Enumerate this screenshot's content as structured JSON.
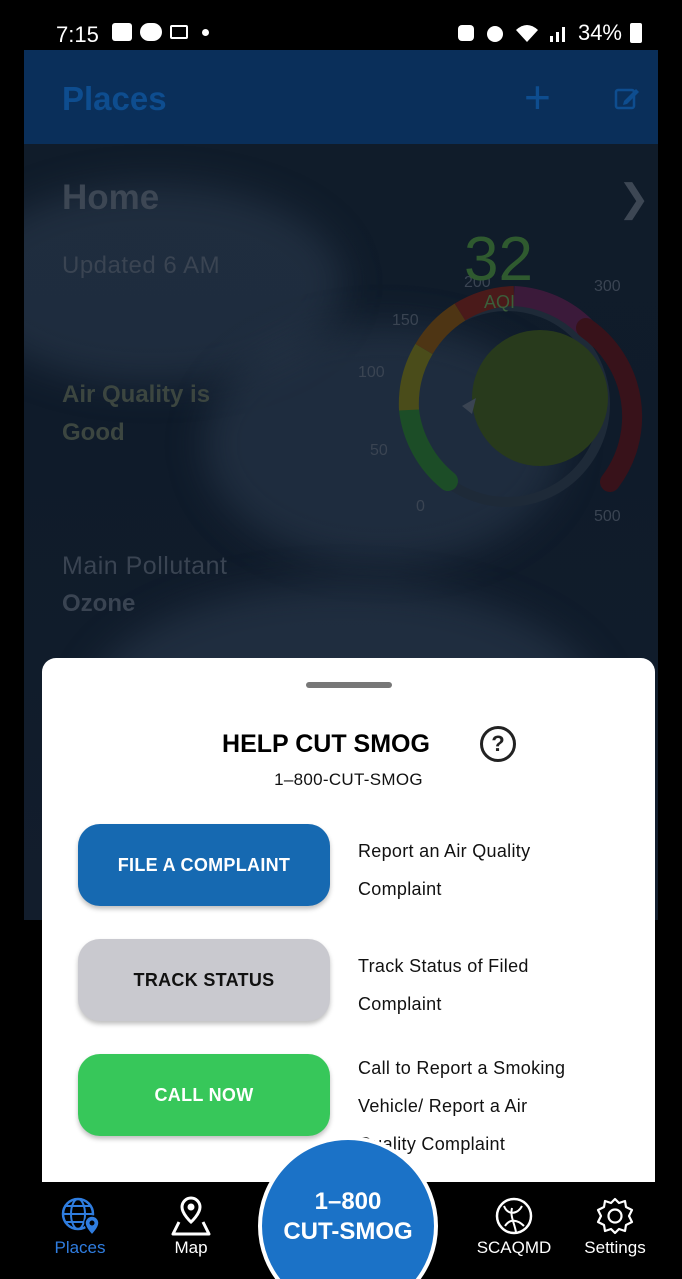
{
  "status_bar": {
    "time": "7:15",
    "battery": "34%"
  },
  "header": {
    "title": "Places",
    "add_icon": "plus-icon",
    "edit_icon": "edit-icon"
  },
  "place": {
    "name": "Home",
    "updated": "Updated 6 AM",
    "air_quality_line1": "Air Quality is",
    "air_quality_line2": "Good",
    "pollutant_label": "Main Pollutant",
    "pollutant_value": "Ozone",
    "aqi_value": "32",
    "aqi_unit": "AQI",
    "gauge_ticks": [
      "0",
      "50",
      "100",
      "150",
      "200",
      "300",
      "500"
    ],
    "gauge_colors": [
      "#37c75a",
      "#e8d21e",
      "#f08a1c",
      "#e0251c",
      "#8e2b8a",
      "#7a1020"
    ]
  },
  "sheet": {
    "title": "HELP CUT SMOG",
    "help_icon": "?",
    "subtitle": "1–800-CUT-SMOG",
    "actions": [
      {
        "label": "FILE A COMPLAINT",
        "description_line1": "Report an Air Quality",
        "description_line2": "Complaint",
        "color": "#1669b1"
      },
      {
        "label": "TRACK STATUS",
        "description_line1": "Track Status of Filed",
        "description_line2": "Complaint",
        "color": "#c9c9cf"
      },
      {
        "label": "CALL NOW",
        "description_line1": "Call to Report a Smoking",
        "description_line2": "Vehicle/ Report a Air",
        "description_line3": "Quality Complaint",
        "color": "#37c75a"
      }
    ]
  },
  "nav": {
    "items": [
      {
        "label": "Places",
        "icon": "globe-pin-icon",
        "active": true
      },
      {
        "label": "Map",
        "icon": "map-pin-icon"
      },
      {
        "label": "SCAQMD",
        "icon": "scaqmd-logo-icon"
      },
      {
        "label": "Settings",
        "icon": "gear-icon"
      }
    ],
    "fab_line1": "1–800",
    "fab_line2": "CUT-SMOG",
    "accent": "#2f7de0"
  }
}
